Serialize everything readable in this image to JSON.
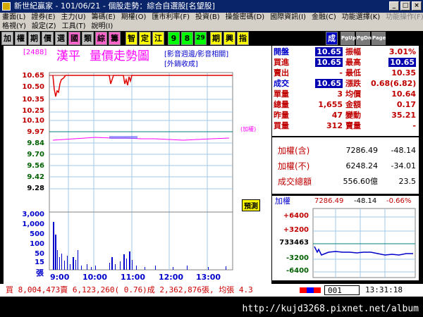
{
  "window": {
    "title": "新世紀贏家 - 101/06/21 - 個股走勢：綜合自選股[名望股]",
    "buttons": {
      "min": "_",
      "max": "□",
      "close": "×"
    }
  },
  "menu": {
    "row1": [
      "畫面(L)",
      "證券(E)",
      "主力(U)",
      "籌碼(E)",
      "期權(O)",
      "匯市利率(F)",
      "投資(B)",
      "操盤密碼(D)",
      "國際資訊(I)",
      "金融(C)",
      "功能選擇(K)",
      "功能操作(F)"
    ],
    "row2": [
      "格視(Y)",
      "設定(Z)",
      "工具(T)",
      "說明(I)"
    ]
  },
  "toolbar": {
    "chars": [
      "加",
      "權",
      "期",
      "價",
      "選",
      "國",
      "類",
      "綜",
      "籌",
      "智",
      "定",
      "江",
      "9",
      "8",
      "29",
      "期",
      "興",
      "指"
    ],
    "right_chars": [
      "成",
      "PgUp",
      "PgDn",
      "Page"
    ]
  },
  "chart": {
    "code": "[2488]",
    "name": "漢平",
    "title": "量價走勢圖",
    "tabs": [
      "影音週邊/影音相關",
      "外銷收成"
    ],
    "price_labels": [
      "10.65",
      "10.50",
      "10.35",
      "10.25",
      "10.10",
      "9.97",
      "9.84",
      "9.70",
      "9.56",
      "9.42",
      "9.28"
    ],
    "volume_labels": [
      "3,000",
      "1,000",
      "500",
      "100",
      "50",
      "15"
    ],
    "volume_unit": "張",
    "time_labels": [
      "9:00",
      "10:00",
      "11:00",
      "12:00",
      "13:00"
    ],
    "index_note": "(加權)",
    "trial_flag": "預測"
  },
  "quote": {
    "rows": [
      {
        "l1": "開盤",
        "v1": "10.65",
        "l2": "振幅",
        "v2": "3.01%"
      },
      {
        "l1": "買進",
        "v1": "10.65",
        "l2": "最高",
        "v2": "10.65"
      },
      {
        "l1": "賣出",
        "v1": "-",
        "l2": "最低",
        "v2": "10.35"
      },
      {
        "l1": "成交",
        "v1": "10.65",
        "l2": "漲跌",
        "v2": "0.68(6.82)"
      },
      {
        "l1": "單量",
        "v1": "3",
        "l2": "均價",
        "v2": "10.64"
      },
      {
        "l1": "總量",
        "v1": "1,655",
        "l2": "金額",
        "v2": "0.17"
      },
      {
        "l1": "昨量",
        "v1": "47",
        "l2": "變動",
        "v2": "35.21"
      },
      {
        "l1": "買量",
        "v1": "312",
        "l2": "賣量",
        "v2": "-"
      }
    ]
  },
  "index": {
    "rows": [
      {
        "label": "加權(含)",
        "value": "7286.49",
        "change": "-48.14"
      },
      {
        "label": "加權(不)",
        "value": "6248.24",
        "change": "-34.01"
      },
      {
        "label": "成交總額",
        "value": "556.60億",
        "change": "23.5"
      }
    ]
  },
  "mini": {
    "label": "加權",
    "value": "7286.49",
    "change": "-48.14",
    "pct": "-0.66%",
    "y_labels": [
      "+6400",
      "+3200",
      "733463",
      "-3200",
      "-6400"
    ]
  },
  "status": {
    "text": "買 8,004,473賣 6,123,260( 0.76)成 2,362,876張, 均張 4.3",
    "counter": "001",
    "clock": "13:31:18"
  },
  "url": "http://kujd3268.pixnet.net/album",
  "colors": {
    "up": "#cc0000",
    "down": "#006000",
    "accent": "#0000cc",
    "name": "#ff00ff"
  }
}
